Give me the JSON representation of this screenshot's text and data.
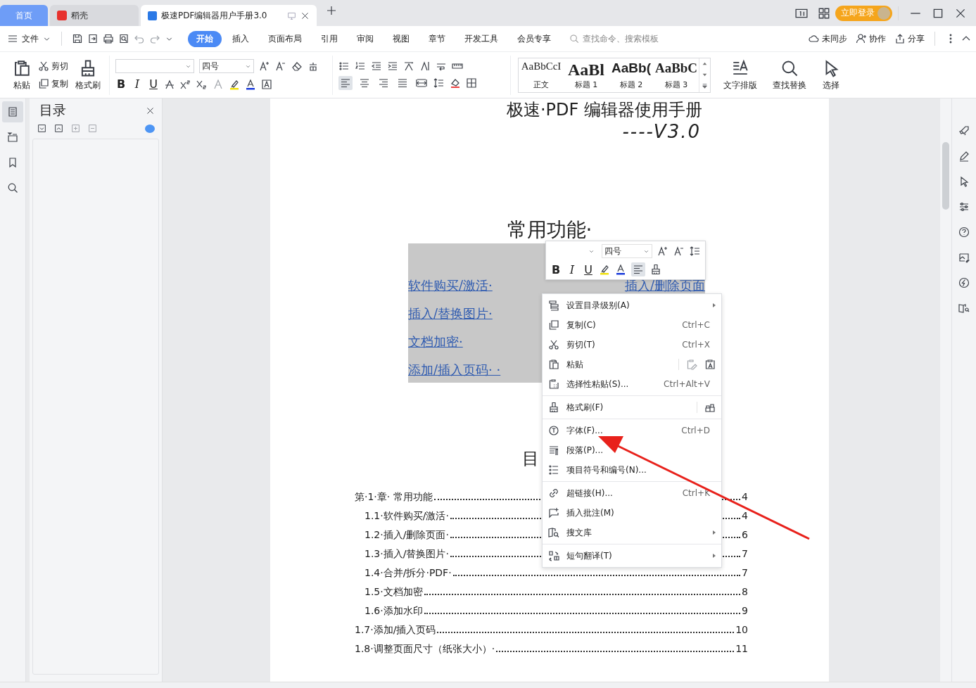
{
  "tabs": [
    {
      "label": "首页",
      "kind": "home",
      "selected": false
    },
    {
      "label": "稻壳",
      "kind": "app",
      "selected": false
    },
    {
      "label": "极速PDF编辑器用户手册3.0",
      "kind": "doc",
      "selected": true
    }
  ],
  "login_button": "立即登录",
  "file_menu": "文件",
  "ribbon_tabs": [
    {
      "label": "开始",
      "selected": true
    },
    {
      "label": "插入",
      "selected": false
    },
    {
      "label": "页面布局",
      "selected": false
    },
    {
      "label": "引用",
      "selected": false
    },
    {
      "label": "审阅",
      "selected": false
    },
    {
      "label": "视图",
      "selected": false
    },
    {
      "label": "章节",
      "selected": false
    },
    {
      "label": "开发工具",
      "selected": false
    },
    {
      "label": "会员专享",
      "selected": false
    }
  ],
  "search": {
    "placeholder": "查找命令、搜索模板"
  },
  "header_actions": [
    "未同步",
    "协作",
    "分享"
  ],
  "clipboard": {
    "paste": "粘贴",
    "cut": "剪切",
    "copy": "复制",
    "format_painter": "格式刷"
  },
  "font": {
    "size": "四号",
    "bold": "B",
    "italic": "I",
    "underline": "U"
  },
  "alignment_buttons": [
    {
      "selected": true
    },
    {
      "selected": false
    },
    {
      "selected": false
    },
    {
      "selected": false
    },
    {
      "selected": false
    }
  ],
  "styles": [
    {
      "preview": "AaBbCcI",
      "label": "正文"
    },
    {
      "preview": "AaBl",
      "label": "标题 1"
    },
    {
      "preview": "AaBb(",
      "label": "标题 2"
    },
    {
      "preview": "AaBbC",
      "label": "标题 3"
    }
  ],
  "tools": [
    "文字排版",
    "查找替换",
    "选择"
  ],
  "nav_panel": {
    "title": "目录"
  },
  "document": {
    "title": "极速·PDF 编辑器使用手册",
    "version": "----V3.0",
    "heading": "常用功能·",
    "left_links": [
      "软件购买/激活·",
      "插入/替换图片·",
      "文档加密·",
      "添加/插入页码· ·"
    ],
    "right_links": [
      "插入/删除页面"
    ],
    "toc_heading": "目",
    "toc": [
      {
        "text": "第·1·章· 常用功能",
        "page": "4",
        "children": [
          {
            "text": "1.1·软件购买/激活·",
            "page": "4"
          },
          {
            "text": "1.2·插入/删除页面·",
            "page": "6"
          },
          {
            "text": "1.3·插入/替换图片·",
            "page": "7"
          },
          {
            "text": "1.4·合并/拆分·PDF·",
            "page": "7"
          },
          {
            "text": "1.5·文档加密",
            "page": "8"
          },
          {
            "text": "1.6·添加水印",
            "page": "9"
          }
        ]
      },
      {
        "text": "1.7·添加/插入页码",
        "page": "10"
      },
      {
        "text": "1.8·调整页面尺寸（纸张大小）·",
        "page": "11"
      }
    ]
  },
  "mini_toolbar": {
    "size": "四号",
    "bold": "B",
    "italic": "I",
    "underline": "U"
  },
  "context_menu": {
    "groups": [
      [
        {
          "label": "设置目录级别(A)",
          "submenu": true
        },
        {
          "label": "复制(C)",
          "shortcut": "Ctrl+C",
          "submenu": false
        },
        {
          "label": "剪切(T)",
          "shortcut": "Ctrl+X",
          "submenu": false
        },
        {
          "label": "粘贴",
          "submenu": false
        },
        {
          "label": "选择性粘贴(S)...",
          "shortcut": "Ctrl+Alt+V",
          "submenu": false
        }
      ],
      [
        {
          "label": "格式刷(F)",
          "submenu": false
        }
      ],
      [
        {
          "label": "字体(F)...",
          "shortcut": "Ctrl+D",
          "submenu": false
        },
        {
          "label": "段落(P)...",
          "submenu": false
        },
        {
          "label": "项目符号和编号(N)...",
          "submenu": false
        }
      ],
      [
        {
          "label": "超链接(H)...",
          "shortcut": "Ctrl+K",
          "submenu": false
        },
        {
          "label": "插入批注(M)",
          "submenu": false
        },
        {
          "label": "搜文库",
          "submenu": true
        }
      ],
      [
        {
          "label": "短句翻译(T)",
          "submenu": true
        }
      ]
    ]
  }
}
